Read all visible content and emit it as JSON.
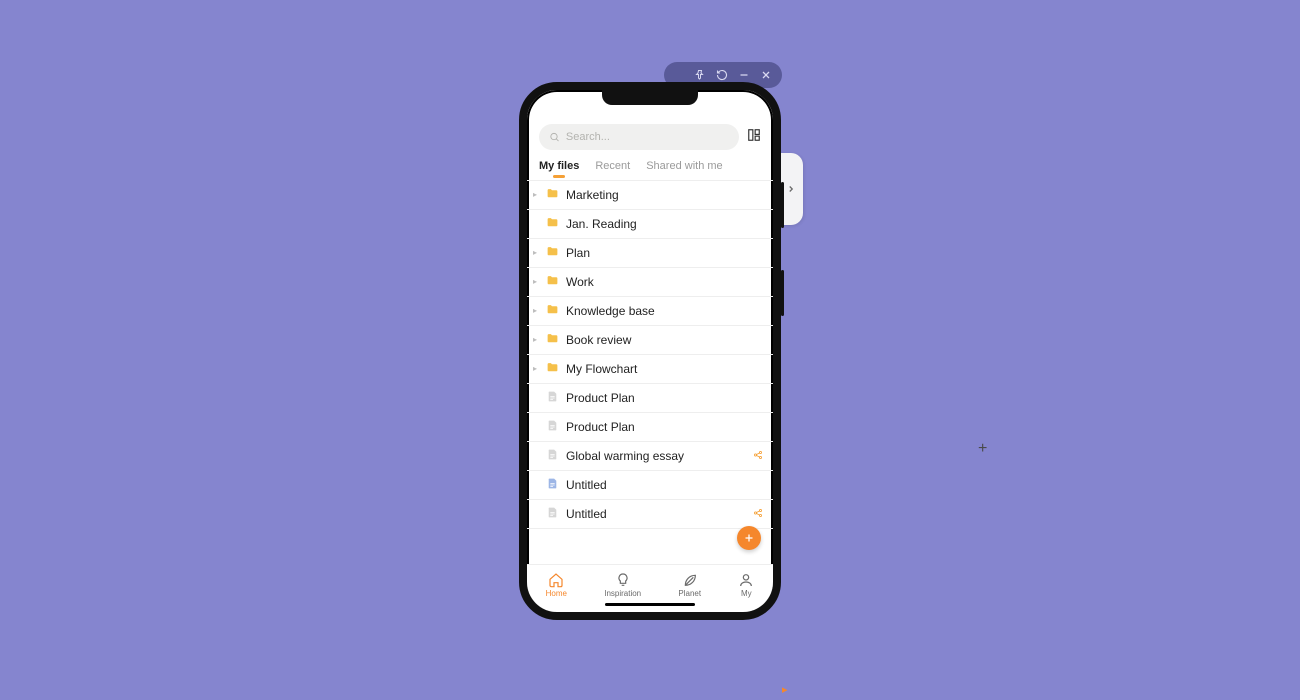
{
  "window": {
    "controls": [
      "pin",
      "undo",
      "minimize",
      "close"
    ]
  },
  "search": {
    "placeholder": "Search..."
  },
  "tabs": [
    {
      "label": "My files",
      "active": true
    },
    {
      "label": "Recent",
      "active": false
    },
    {
      "label": "Shared with me",
      "active": false
    }
  ],
  "items": [
    {
      "type": "folder",
      "label": "Marketing",
      "expandable": true
    },
    {
      "type": "folder",
      "label": "Jan. Reading",
      "expandable": false
    },
    {
      "type": "folder",
      "label": "Plan",
      "expandable": true
    },
    {
      "type": "folder",
      "label": "Work",
      "expandable": true
    },
    {
      "type": "folder",
      "label": "Knowledge base",
      "expandable": true
    },
    {
      "type": "folder",
      "label": "Book review",
      "expandable": true
    },
    {
      "type": "folder",
      "label": "My Flowchart",
      "expandable": true
    },
    {
      "type": "doc",
      "label": "Product Plan"
    },
    {
      "type": "doc",
      "label": "Product Plan"
    },
    {
      "type": "doc",
      "label": "Global warming essay",
      "shared": true
    },
    {
      "type": "doc-blue",
      "label": "Untitled"
    },
    {
      "type": "doc",
      "label": "Untitled",
      "shared": true
    }
  ],
  "nav": [
    {
      "label": "Home",
      "icon": "home",
      "active": true
    },
    {
      "label": "Inspiration",
      "icon": "bulb"
    },
    {
      "label": "Planet",
      "icon": "leaf"
    },
    {
      "label": "My",
      "icon": "user"
    }
  ]
}
